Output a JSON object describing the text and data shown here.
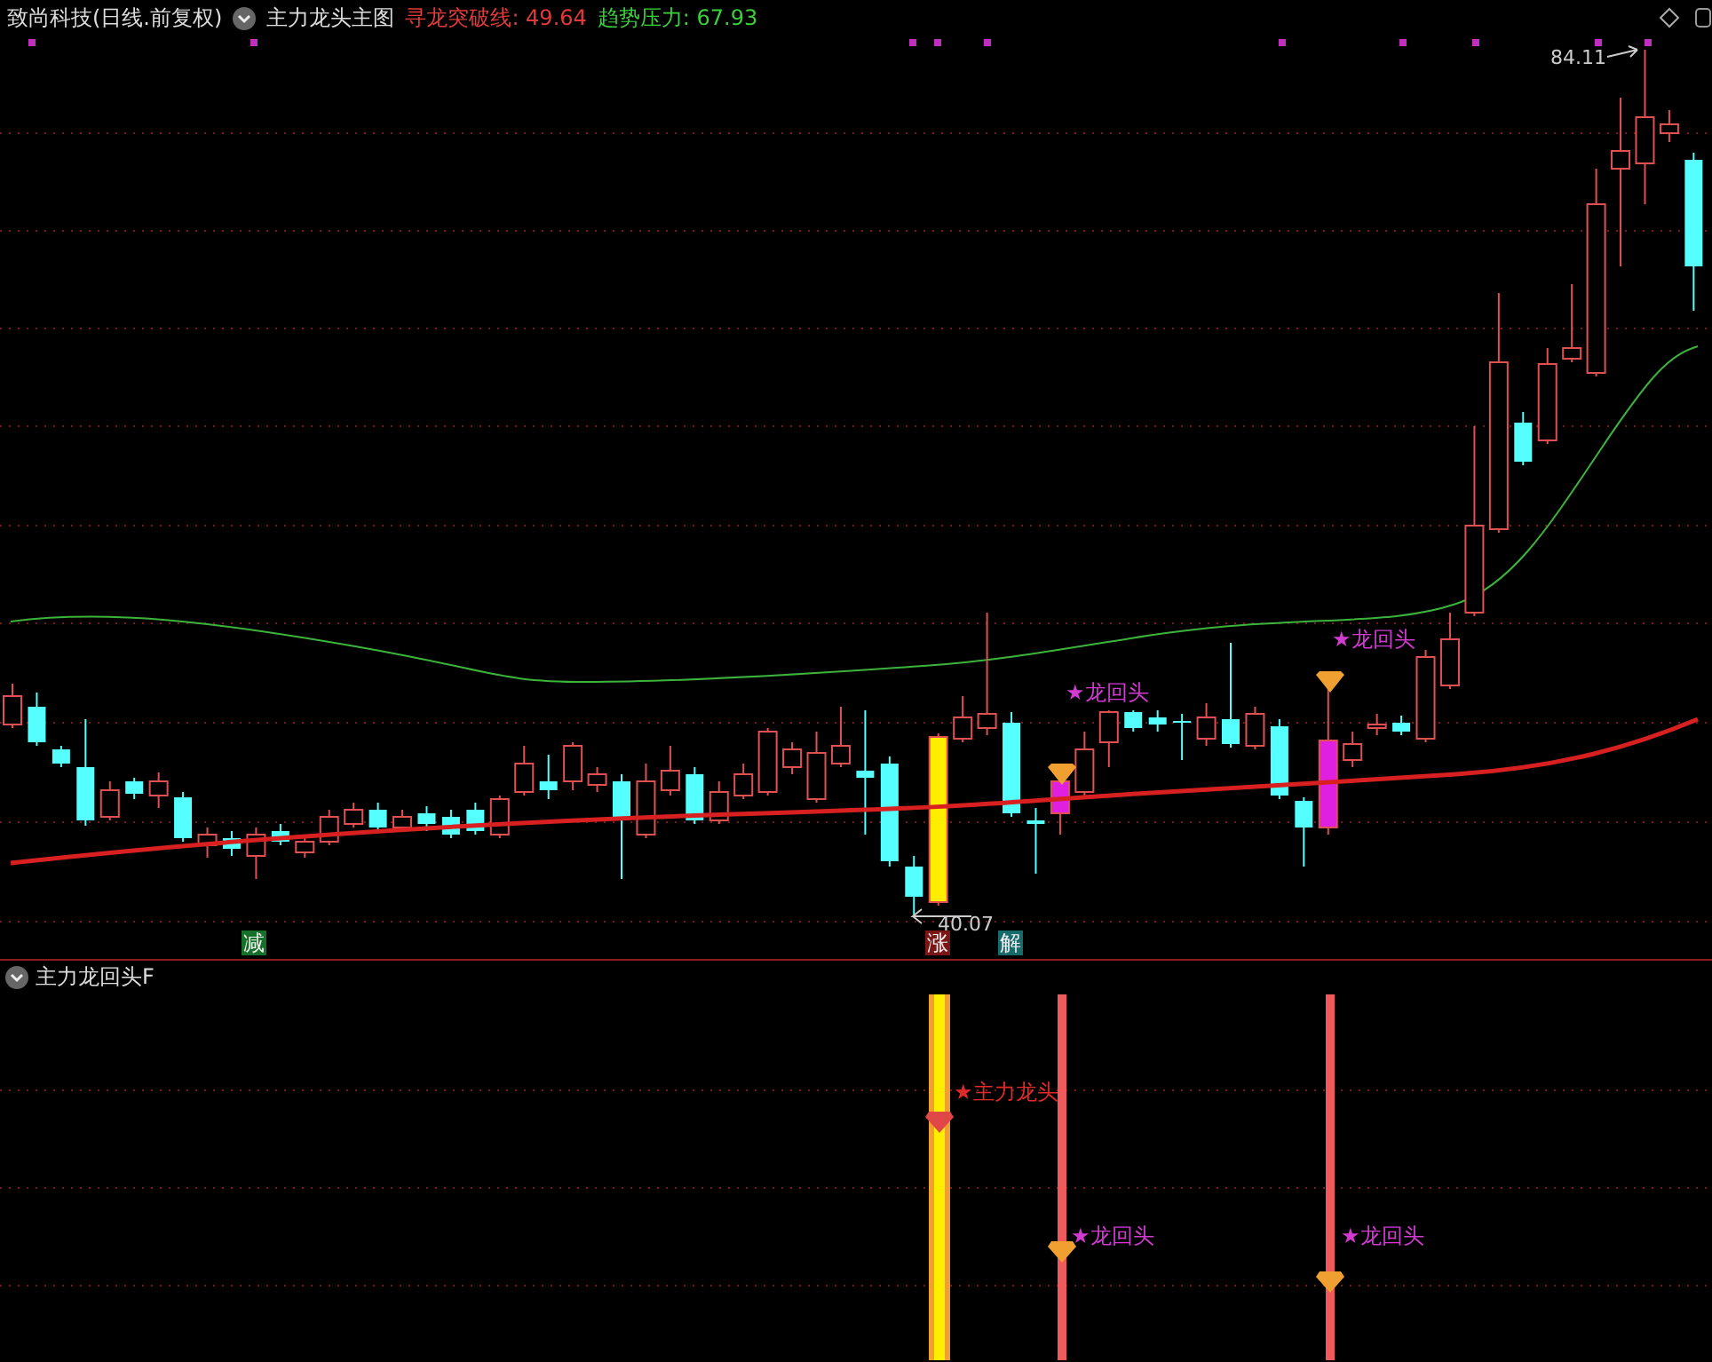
{
  "header": {
    "security": "致尚科技(日线.前复权)",
    "indicator": "主力龙头主图",
    "readouts": [
      {
        "text": "寻龙突破线: 49.64",
        "color": "#e23a3a"
      },
      {
        "text": "趋势压力: 67.93",
        "color": "#3ccf3c"
      }
    ]
  },
  "main_chart": {
    "high_label": "84.11",
    "low_label": "40.07",
    "signals": [
      {
        "text": "★龙回头"
      },
      {
        "text": "★龙回头"
      }
    ],
    "tags": [
      {
        "text": "减",
        "color": "#17702a"
      },
      {
        "text": "涨",
        "color": "#7a1616"
      },
      {
        "text": "解",
        "color": "#166a6a"
      }
    ]
  },
  "sub_panel": {
    "title": "主力龙回头F",
    "signals": [
      {
        "text": "★主力龙头",
        "color": "#e02a2a"
      },
      {
        "text": "★龙回头",
        "color": "#d23ad2"
      },
      {
        "text": "★龙回头",
        "color": "#d23ad2"
      }
    ]
  }
}
